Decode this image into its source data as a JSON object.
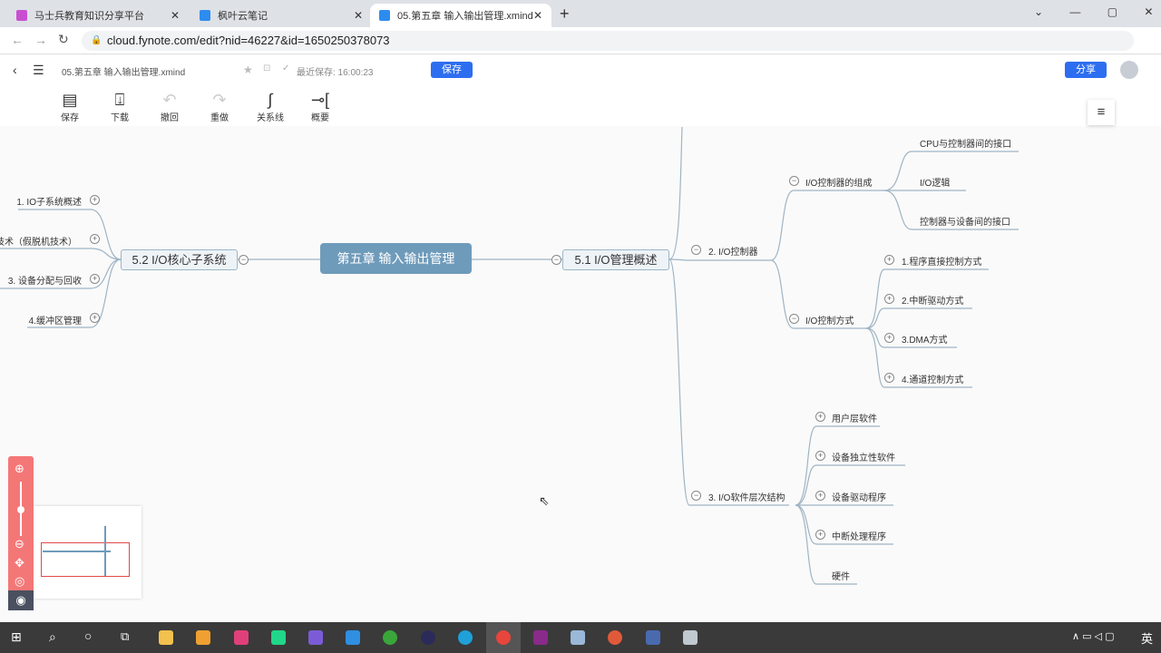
{
  "browser": {
    "tabs": [
      {
        "title": "马士兵教育知识分享平台"
      },
      {
        "title": "枫叶云笔记"
      },
      {
        "title": "05.第五章 输入输出管理.xmind",
        "active": true
      }
    ],
    "url": "cloud.fynote.com/edit?nid=46227&id=1650250378073"
  },
  "app": {
    "filename": "05.第五章 输入输出管理.xmind",
    "last_saved": "最近保存: 16:00:23",
    "save_button": "保存",
    "share_button": "分享",
    "toolbar": [
      "保存",
      "下载",
      "撤回",
      "重做",
      "关系线",
      "概要"
    ]
  },
  "mindmap": {
    "root": "第五章 输入输出管理",
    "left": {
      "title": "5.2 I/O核心子系统",
      "children": [
        "1. IO子系统概述",
        "技术（假脱机技术）",
        "3. 设备分配与回收",
        "4.缓冲区管理"
      ]
    },
    "right": {
      "title": "5.1 I/O管理概述",
      "controller": {
        "title": "2. I/O控制器",
        "composition": {
          "title": "I/O控制器的组成",
          "children": [
            "CPU与控制器间的接口",
            "I/O逻辑",
            "控制器与设备间的接口"
          ]
        },
        "modes": {
          "title": "I/O控制方式",
          "children": [
            "1.程序直接控制方式",
            "2.中断驱动方式",
            "3.DMA方式",
            "4.通道控制方式"
          ]
        }
      },
      "software": {
        "title": "3. I/O软件层次结构",
        "children": [
          "用户层软件",
          "设备独立性软件",
          "设备驱动程序",
          "中断处理程序",
          "硬件"
        ]
      }
    }
  },
  "taskbar": {
    "ime": "英"
  },
  "colors": {
    "accent": "#2d6ef0",
    "root": "#6f9bbb",
    "zoom_panel": "#f47777"
  }
}
